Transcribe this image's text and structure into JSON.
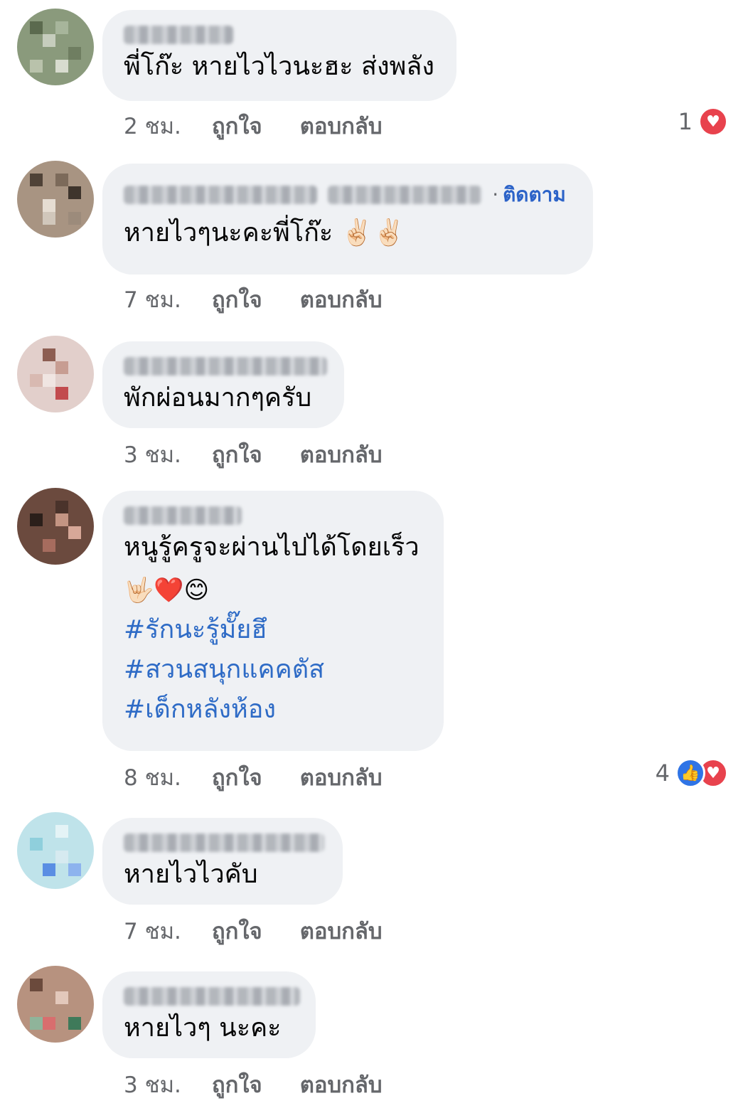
{
  "labels": {
    "like": "ถูกใจ",
    "reply": "ตอบกลับ"
  },
  "colors": {
    "bubble": "#eff1f4",
    "link": "#2c63c8",
    "meta": "#65676b",
    "love": "#e8424d",
    "like": "#2f74e6"
  },
  "comments": [
    {
      "text": "พี่โก๊ะ หายไวไวนะฮะ ส่งพลัง",
      "time": "2 ชม.",
      "reaction_count": "1",
      "reactions": [
        "love-icon"
      ]
    },
    {
      "follow": "ติดตาม",
      "text": "หายไวๆนะคะพี่โก๊ะ ✌🏻✌🏻",
      "time": "7 ชม."
    },
    {
      "text": "พักผ่อนมากๆครับ",
      "time": "3 ชม."
    },
    {
      "text": "หนูรู้ครูจะผ่านไปได้โดยเร็ว",
      "emojis": "🤟🏻❤️😊",
      "hashtags": [
        "#รักนะรู้มั๊ยฮึ",
        "#สวนสนุกแคคตัส",
        "#เด็กหลังห้อง"
      ],
      "time": "8 ชม.",
      "reaction_count": "4",
      "reactions": [
        "like-icon",
        "love-icon"
      ]
    },
    {
      "text": "หายไวไวคับ",
      "time": "7 ชม."
    },
    {
      "text": "หายไวๆ นะคะ",
      "time": "3 ชม."
    }
  ]
}
